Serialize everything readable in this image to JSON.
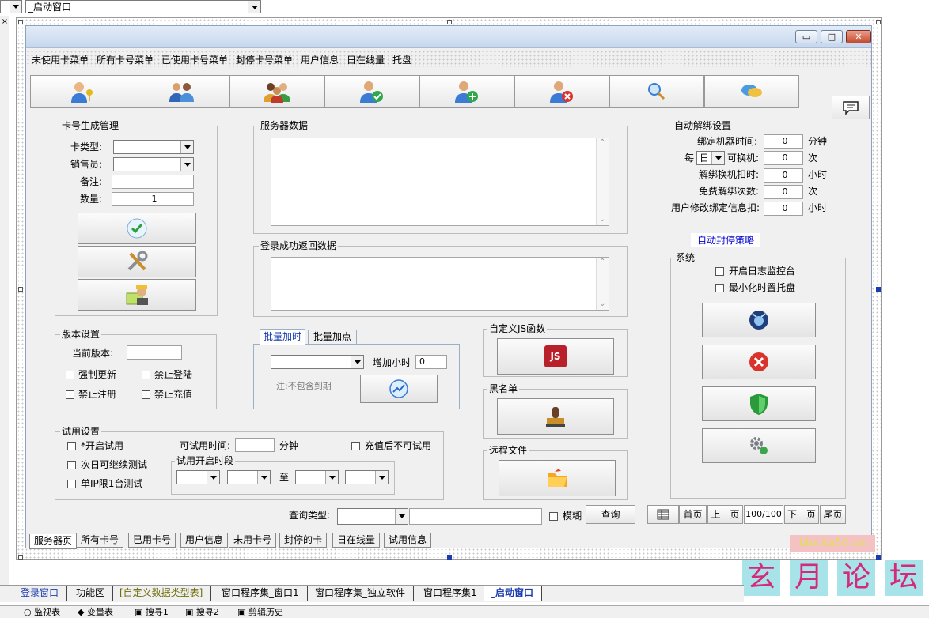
{
  "ide": {
    "top_combo_value": "_启动窗口",
    "watermark": "bbs.ka50.cn",
    "forum_chars": [
      "玄",
      "月",
      "论",
      "坛"
    ],
    "bottom_tabs": [
      "登录窗口",
      "功能区",
      "[自定义数据类型表]",
      "窗口程序集_窗口1",
      "窗口程序集_独立软件",
      "窗口程序集1",
      "_启动窗口"
    ],
    "status_items": [
      "监视表",
      "变量表",
      "搜寻1",
      "搜寻2",
      "剪辑历史"
    ]
  },
  "window": {
    "buttons": {
      "min": "▭",
      "max": "□",
      "close": "✕"
    },
    "menu": [
      "未使用卡菜单",
      "所有卡号菜单",
      "已使用卡号菜单",
      "封停卡号菜单",
      "用户信息",
      "日在线量",
      "托盘"
    ],
    "toolbar_icons": [
      "user-key-icon",
      "users-icon",
      "group-icon",
      "user-check-icon",
      "user-add-icon",
      "user-delete-icon",
      "search-icon",
      "chat-icon"
    ]
  },
  "card_gen": {
    "title": "卡号生成管理",
    "type_label": "卡类型:",
    "seller_label": "销售员:",
    "note_label": "备注:",
    "qty_label": "数量:",
    "qty_value": "1"
  },
  "version": {
    "title": "版本设置",
    "current_label": "当前版本:",
    "force_update": "强制更新",
    "no_login": "禁止登陆",
    "no_register": "禁止注册",
    "no_recharge": "禁止充值"
  },
  "trial": {
    "title": "试用设置",
    "enable": "*开启试用",
    "next_day": "次日可继续测试",
    "single_ip": "单IP限1台测试",
    "time_label": "可试用时间:",
    "minutes": "分钟",
    "no_after_recharge": "充值后不可试用",
    "period_title": "试用开启时段",
    "to": "至"
  },
  "server": {
    "data_title": "服务器数据",
    "login_return_title": "登录成功返回数据"
  },
  "batch": {
    "tabs": [
      "批量加时",
      "批量加点"
    ],
    "add_hours": "增加小时",
    "hours_value": "0",
    "note": "注:不包含到期"
  },
  "custom_js": {
    "title": "自定义JS函数",
    "icon_text": "JS"
  },
  "blacklist": {
    "title": "黑名单"
  },
  "remote_file": {
    "title": "远程文件"
  },
  "auto_unbind": {
    "title": "自动解绑设置",
    "bind_time": "绑定机器时间:",
    "bind_time_value": "0",
    "bind_time_unit": "分钟",
    "per": "每",
    "day_value": "日",
    "can_change": "可换机:",
    "can_change_value": "0",
    "times": "次",
    "unbind_deduct": "解绑换机扣时:",
    "unbind_deduct_value": "0",
    "hours": "小时",
    "free_unbind": "免费解绑次数:",
    "free_unbind_value": "0",
    "user_modify": "用户修改绑定信息扣:",
    "user_modify_value": "0"
  },
  "auto_ban_link": "自动封停策略",
  "system": {
    "title": "系统",
    "log_monitor": "开启日志监控台",
    "minimize_tray": "最小化时置托盘"
  },
  "query": {
    "type_label": "查询类型:",
    "fuzzy": "模糊",
    "search_btn": "查询"
  },
  "pager": {
    "first": "首页",
    "prev": "上一页",
    "page": "100/100",
    "next": "下一页",
    "last": "尾页"
  },
  "bottom_tabs": [
    "服务器页",
    "所有卡号",
    "已用卡号",
    "用户信息",
    "未用卡号",
    "封停的卡",
    "日在线量",
    "试用信息"
  ],
  "colors": {
    "js_red": "#b8202a",
    "link_blue": "#0000cc",
    "watermark_bg": "#f4c2c2",
    "forum_bg": "#a7e3e8",
    "forum_fg": "#d42a7a"
  }
}
